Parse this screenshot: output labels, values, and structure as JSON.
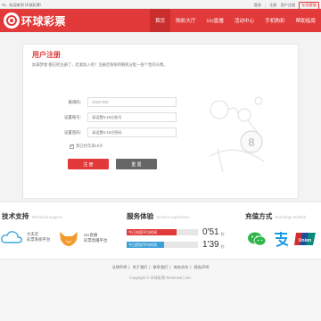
{
  "topbar": {
    "greeting": "Hi，欢迎来到 环球彩票！",
    "login": "登录",
    "register": "注册",
    "user_center": "用户注册",
    "online_service": "在线客服"
  },
  "header": {
    "logo_text": "环球彩票",
    "nav": [
      "首页",
      "购彩大厅",
      "UU直播",
      "活动中心",
      "手机购彩",
      "帮助指南"
    ],
    "active_index": 0,
    "brand_color": "#e23a3a"
  },
  "form": {
    "title": "用户注册",
    "description": "加满梦想 都已经注册了，赶紧加入吧！注册后系统将随机分配一张个性的头像。",
    "fields": [
      {
        "label": "邀请码：",
        "value": "10107333",
        "placeholder": ""
      },
      {
        "label": "设置账号：",
        "value": "",
        "placeholder": "请设置6-16位账号"
      },
      {
        "label": "设置密码：",
        "value": "",
        "placeholder": "请设置6-16位密码"
      }
    ],
    "agree_text": "我已经年满18岁",
    "agree_checked": true,
    "register_button": "注 册",
    "reset_button": "重 置"
  },
  "features": {
    "tech": {
      "title": "技术支持",
      "title_en": "Technical support",
      "items": [
        {
          "line1": "大夫云",
          "line2": "彩票系统平台",
          "icon": "cloud-icon"
        },
        {
          "line1": "UU直播",
          "line2": "彩票直播平台",
          "icon": "fox-icon"
        }
      ]
    },
    "service": {
      "title": "服务体验",
      "title_en": "Service experience",
      "rows": [
        {
          "label": "今日充值平均时间",
          "time": "0'51",
          "unit": "秒",
          "fill_pct": 70,
          "color": "#e23a3a"
        },
        {
          "label": "今日提现平均时间",
          "time": "1'39",
          "unit": "秒",
          "fill_pct": 52,
          "color": "#3aa0d8"
        }
      ]
    },
    "payment": {
      "title": "充值方式",
      "title_en": "Recharge method",
      "methods": [
        {
          "icon": "wechat-pay-icon",
          "color": "#2fb64a"
        },
        {
          "icon": "alipay-icon",
          "color": "#1a9be6"
        },
        {
          "icon": "unionpay-icon",
          "color": "#d22e2e"
        }
      ]
    }
  },
  "footer": {
    "links": [
      "法律声明",
      "关于我们",
      "联系我们",
      "商务合作",
      "隐私声明"
    ],
    "copyright": "Copyright © 环球彩票 Reserved | 18+"
  }
}
